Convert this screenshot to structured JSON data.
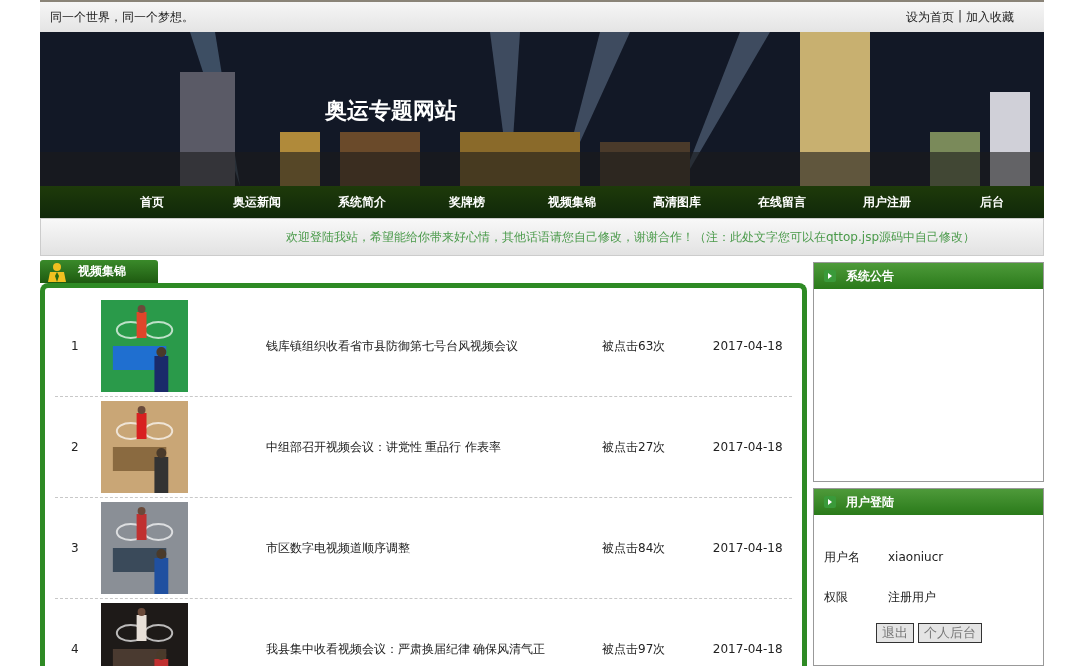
{
  "top_bar": {
    "slogan": "同一个世界，同一个梦想。",
    "links": [
      {
        "label": "设为首页"
      },
      {
        "label": "加入收藏"
      }
    ],
    "separator": "|"
  },
  "banner": {
    "title": "奥运专题网站"
  },
  "nav": [
    {
      "label": "首页"
    },
    {
      "label": "奥运新闻"
    },
    {
      "label": "系统简介"
    },
    {
      "label": "奖牌榜"
    },
    {
      "label": "视频集锦"
    },
    {
      "label": "高清图库"
    },
    {
      "label": "在线留言"
    },
    {
      "label": "用户注册"
    },
    {
      "label": "后台"
    }
  ],
  "marquee": "欢迎登陆我站，希望能给你带来好心情，其他话语请您自己修改，谢谢合作！（注：此处文字您可以在qttop.jsp源码中自己修改）",
  "video_panel": {
    "title": "视频集锦",
    "rows": [
      {
        "index": "1",
        "title": "钱库镇组织收看省市县防御第七号台风视频会议",
        "clicks": "被点击63次",
        "date": "2017-04-18"
      },
      {
        "index": "2",
        "title": "中组部召开视频会议：讲党性 重品行 作表率",
        "clicks": "被点击27次",
        "date": "2017-04-18"
      },
      {
        "index": "3",
        "title": "市区数字电视频道顺序调整",
        "clicks": "被点击84次",
        "date": "2017-04-18"
      },
      {
        "index": "4",
        "title": "我县集中收看视频会议：严肃换届纪律 确保风清气正",
        "clicks": "被点击97次",
        "date": "2017-04-18"
      }
    ]
  },
  "notice_panel": {
    "title": "系统公告"
  },
  "login_panel": {
    "title": "用户登陆",
    "fields": [
      {
        "label": "用户名",
        "value": "xiaoniucr"
      },
      {
        "label": "权限",
        "value": "注册用户"
      }
    ],
    "buttons": [
      {
        "label": "退出"
      },
      {
        "label": "个人后台"
      }
    ]
  }
}
